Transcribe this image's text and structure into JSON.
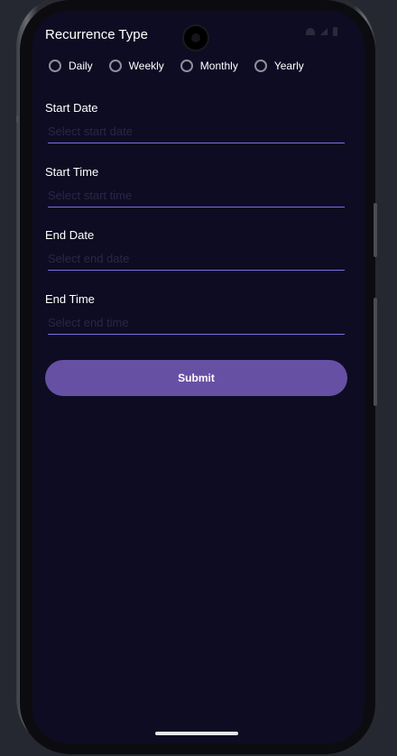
{
  "form": {
    "recurrence_title": "Recurrence Type",
    "recurrence_options": [
      {
        "label": "Daily",
        "selected": false
      },
      {
        "label": "Weekly",
        "selected": false
      },
      {
        "label": "Monthly",
        "selected": false
      },
      {
        "label": "Yearly",
        "selected": false
      }
    ],
    "fields": [
      {
        "label": "Start Date",
        "placeholder": "Select start date",
        "value": ""
      },
      {
        "label": "Start Time",
        "placeholder": "Select start time",
        "value": ""
      },
      {
        "label": "End Date",
        "placeholder": "Select end date",
        "value": ""
      },
      {
        "label": "End Time",
        "placeholder": "Select end time",
        "value": ""
      }
    ],
    "submit_label": "Submit"
  },
  "colors": {
    "background": "#0e0c23",
    "accent": "#6650a4",
    "underline": "#7a6ee0",
    "text": "#ffffff"
  },
  "icons": {
    "status": [
      "wifi-icon",
      "signal-icon",
      "battery-icon"
    ]
  }
}
